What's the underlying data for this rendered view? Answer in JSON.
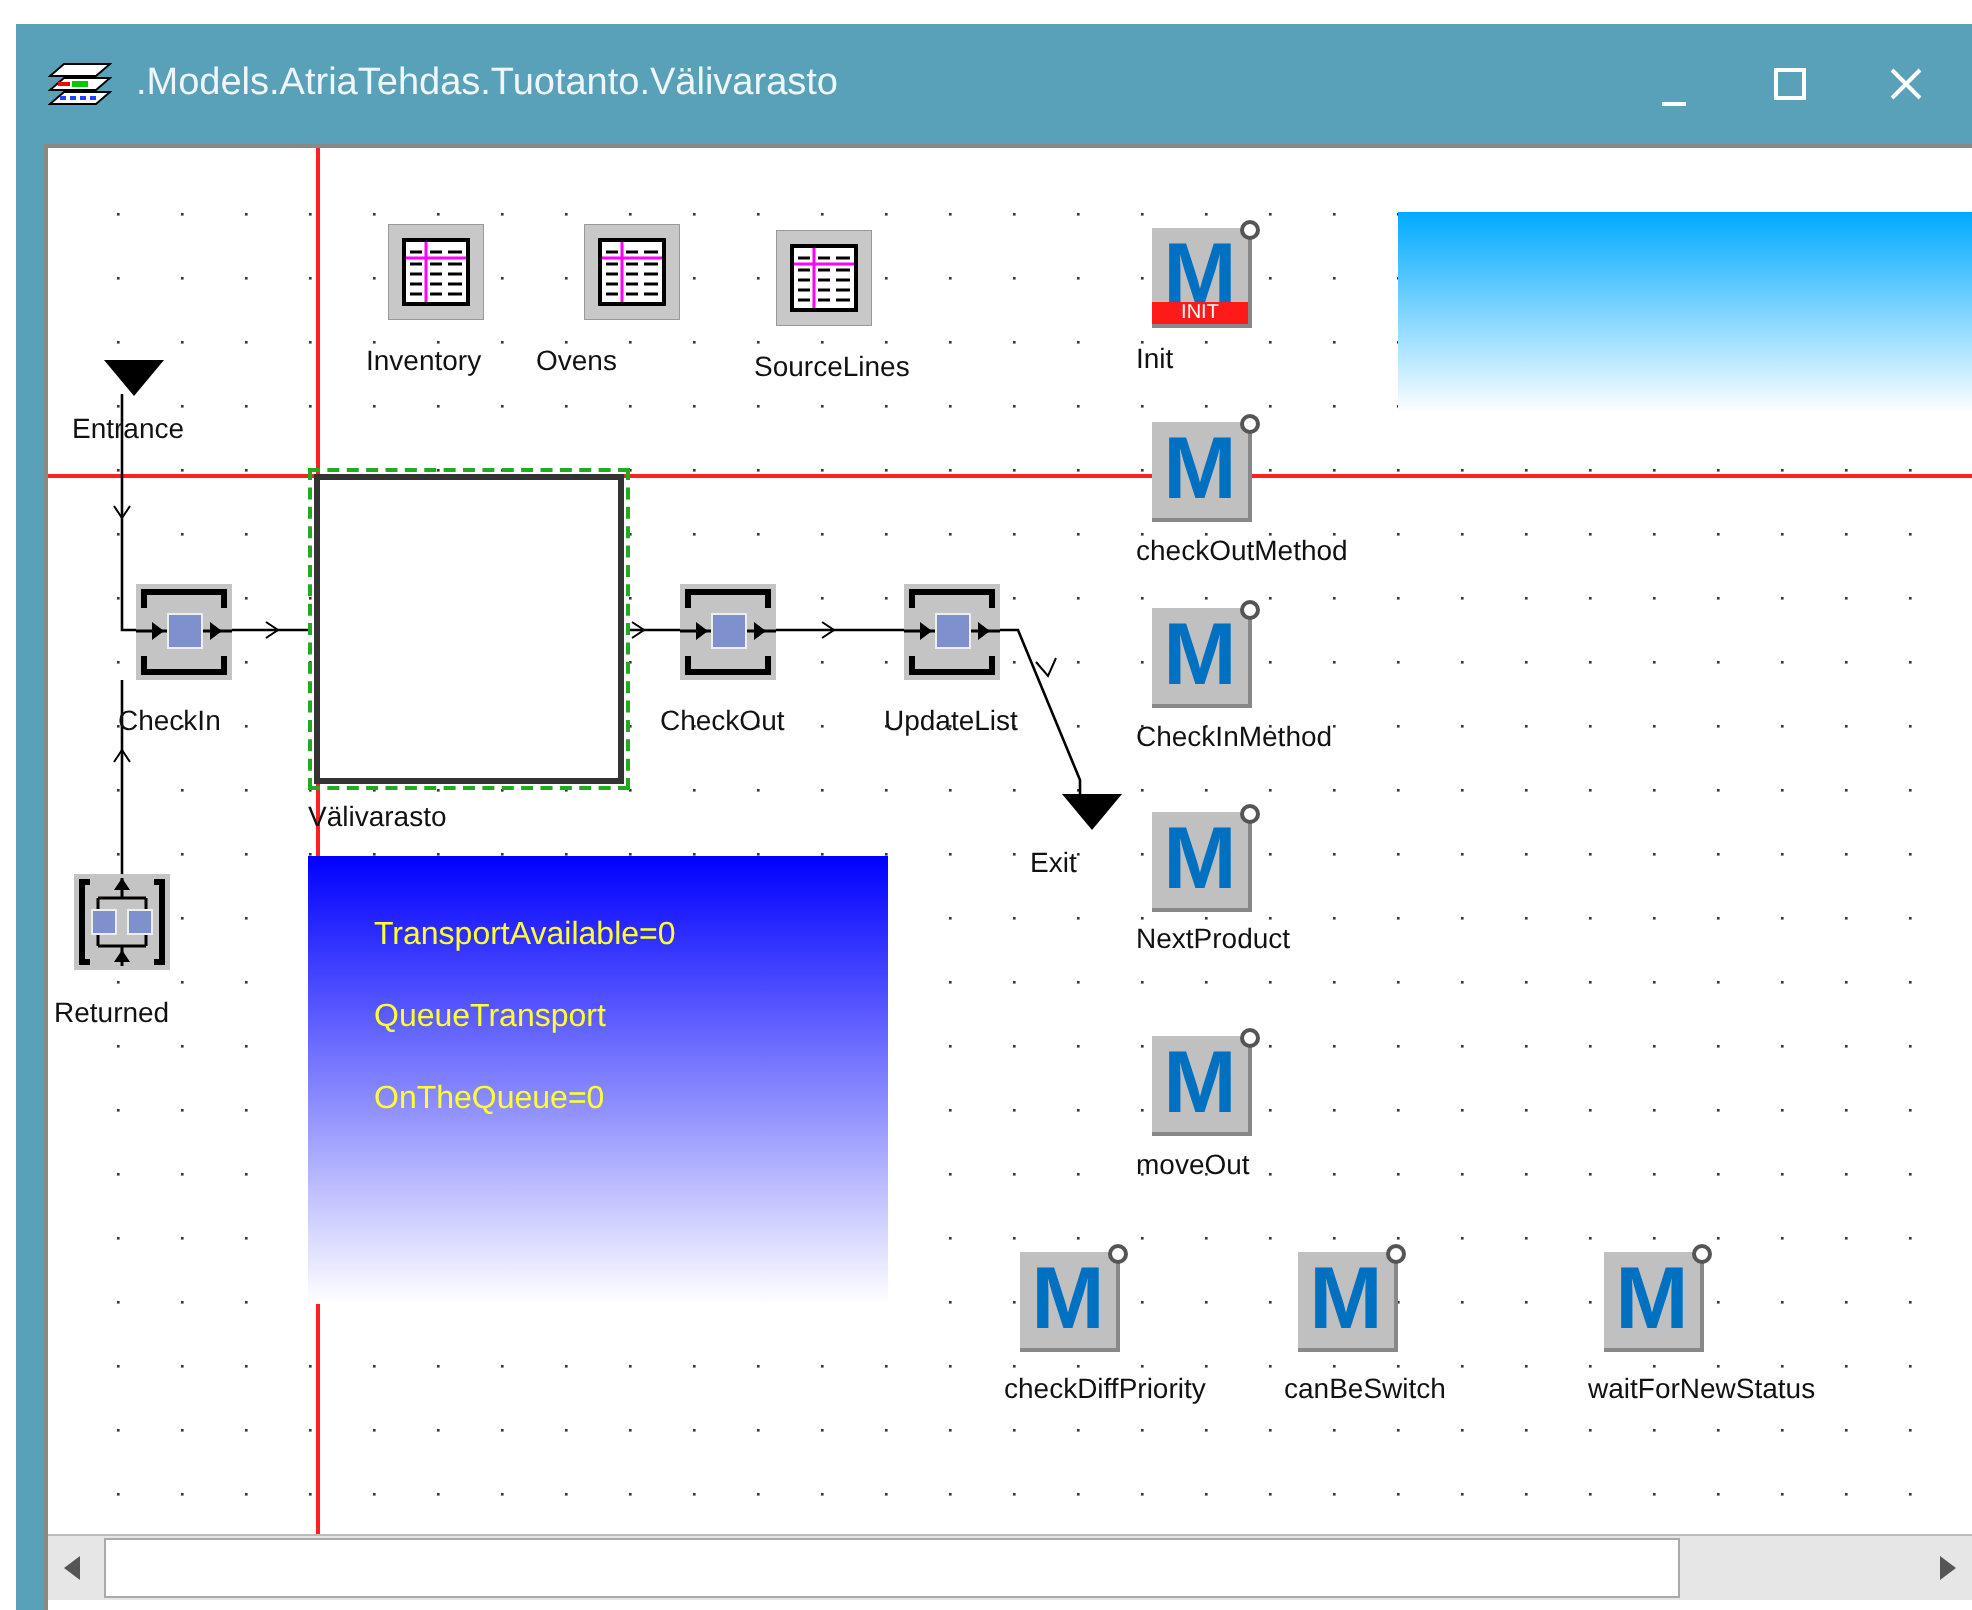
{
  "window": {
    "title": ".Models.AtriaTehdas.Tuotanto.Välivarasto"
  },
  "nodes": [
    {
      "kind": "table",
      "label": "Inventory"
    },
    {
      "kind": "table",
      "label": "Ovens"
    },
    {
      "kind": "table",
      "label": "SourceLines"
    },
    {
      "kind": "method",
      "glyph": "M",
      "badge": "INIT",
      "label": "Init"
    },
    {
      "kind": "method",
      "glyph": "M",
      "label": "checkOutMethod"
    },
    {
      "kind": "method",
      "glyph": "M",
      "label": "CheckInMethod"
    },
    {
      "kind": "method",
      "glyph": "M",
      "label": "NextProduct"
    },
    {
      "kind": "method",
      "glyph": "M",
      "label": "moveOut"
    },
    {
      "kind": "method",
      "glyph": "M",
      "label": "checkDiffPriority"
    },
    {
      "kind": "method",
      "glyph": "M",
      "label": "canBeSwitch"
    },
    {
      "kind": "method",
      "glyph": "M",
      "label": "waitForNewStatus"
    },
    {
      "kind": "source",
      "label": "Entrance"
    },
    {
      "kind": "station",
      "label": "CheckIn"
    },
    {
      "kind": "frame",
      "label": "Välivarasto"
    },
    {
      "kind": "station",
      "label": "CheckOut"
    },
    {
      "kind": "station",
      "label": "UpdateList"
    },
    {
      "kind": "drain",
      "label": "Exit"
    },
    {
      "kind": "assembly",
      "label": "Returned"
    }
  ],
  "panels": [
    {
      "color": "#0000ff",
      "lines": [
        "TransportAvailable=0",
        "QueueTransport",
        "OnTheQueue=0"
      ]
    },
    {
      "color": "#00aaff"
    }
  ]
}
